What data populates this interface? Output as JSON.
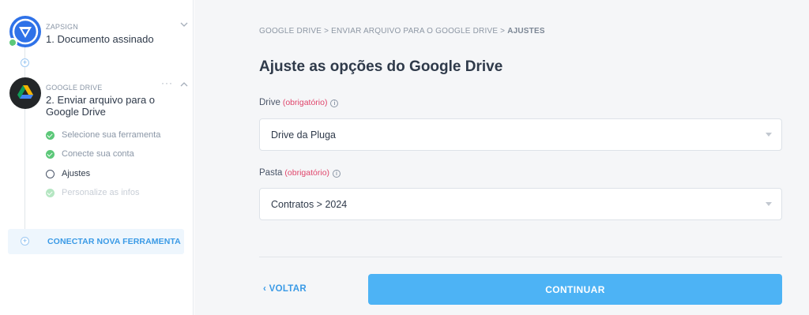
{
  "sidebar": {
    "steps": [
      {
        "app_name": "ZAPSIGN",
        "title": "1. Documento assinado",
        "icon": "zapsign-logo"
      },
      {
        "app_name": "GOOGLE DRIVE",
        "title_line1": "2. Enviar arquivo para o",
        "title_line2": "Google Drive",
        "icon": "google-drive-logo",
        "more": "···",
        "substeps": [
          {
            "label": "Selecione sua ferramenta",
            "state": "done"
          },
          {
            "label": "Conecte sua conta",
            "state": "done"
          },
          {
            "label": "Ajustes",
            "state": "current"
          },
          {
            "label": "Personalize as infos",
            "state": "pending"
          }
        ]
      }
    ],
    "connect_button": "CONECTAR NOVA FERRAMENTA"
  },
  "main": {
    "breadcrumb": {
      "path": "GOOGLE DRIVE > ENVIAR ARQUIVO PARA O GOOGLE DRIVE > ",
      "current": "AJUSTES"
    },
    "title": "Ajuste as opções do Google Drive",
    "fields": [
      {
        "label": "Drive",
        "required_text": "(obrigatório)",
        "value": "Drive da Pluga"
      },
      {
        "label": "Pasta",
        "required_text": "(obrigatório)",
        "value": "Contratos > 2024"
      }
    ],
    "back_label": "‹  VOLTAR",
    "continue_label": "CONTINUAR"
  },
  "colors": {
    "accent": "#4db3f5",
    "link": "#3a9ae6",
    "success": "#5cc879",
    "required": "#e0456b"
  }
}
